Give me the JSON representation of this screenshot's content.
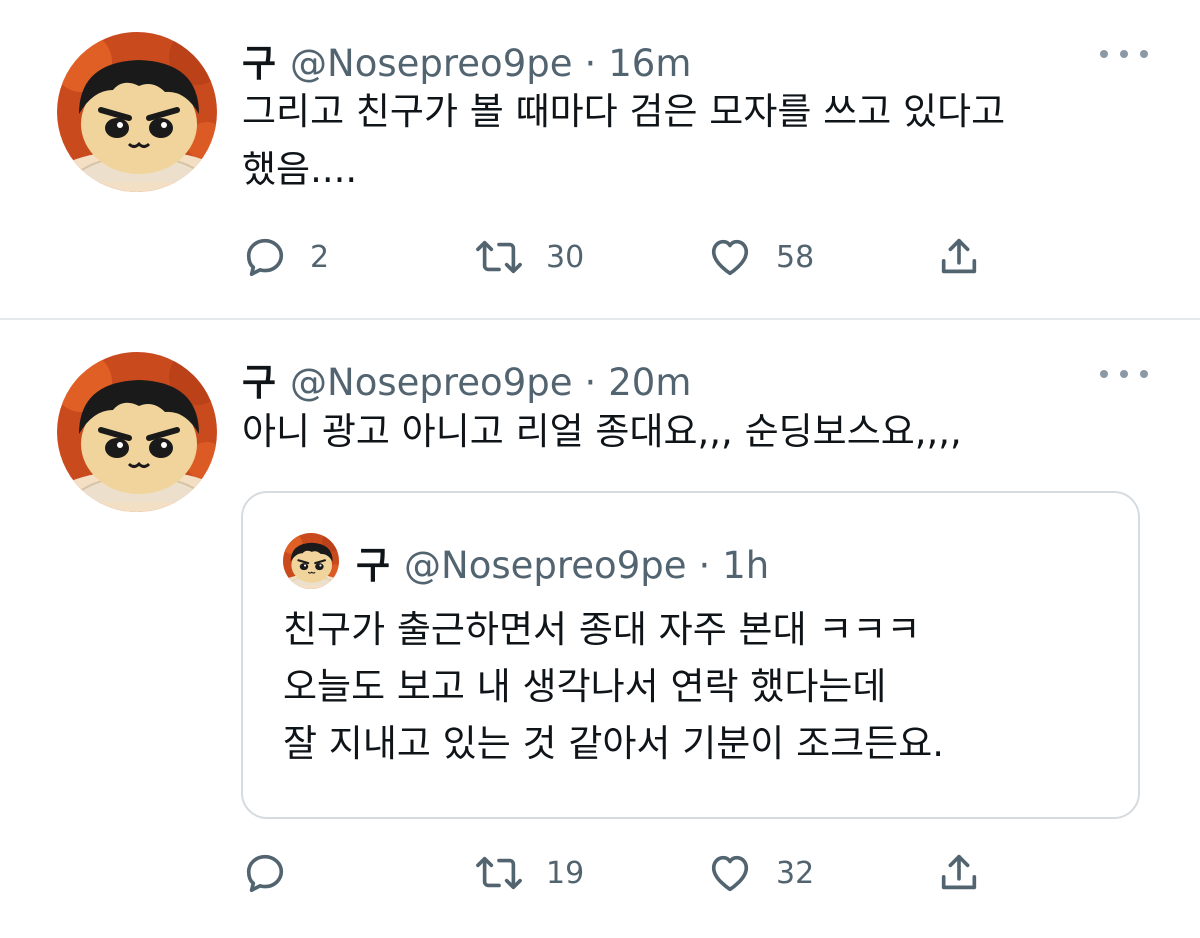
{
  "tweets": [
    {
      "name": "구",
      "handle": "@Nosepreo9pe",
      "dot": "·",
      "time": "16m",
      "text_lines": [
        "그리고 친구가 볼 때마다 검은 모자를 쓰고 있다고",
        "했음...."
      ],
      "reply_count": "2",
      "retweet_count": "30",
      "like_count": "58"
    },
    {
      "name": "구",
      "handle": "@Nosepreo9pe",
      "dot": "·",
      "time": "20m",
      "text_lines": [
        "아니 광고 아니고 리얼 종대요,,, 순딩보스요,,,,"
      ],
      "reply_count": "",
      "retweet_count": "19",
      "like_count": "32",
      "quoted": {
        "name": "구",
        "handle": "@Nosepreo9pe",
        "dot": "·",
        "time": "1h",
        "text_lines": [
          "친구가 출근하면서 종대 자주 본대 ㅋㅋㅋ",
          "오늘도 보고 내 생각나서 연락 했다는데",
          "잘 지내고 있는 것 같아서 기분이 조크든요."
        ]
      }
    }
  ],
  "icons": {
    "reply": "reply-icon",
    "retweet": "retweet-icon",
    "like": "heart-icon",
    "share": "share-icon",
    "more": "more-icon"
  },
  "colors": {
    "secondary_text": "#536471",
    "avatar_bg": "#c94a1d"
  }
}
